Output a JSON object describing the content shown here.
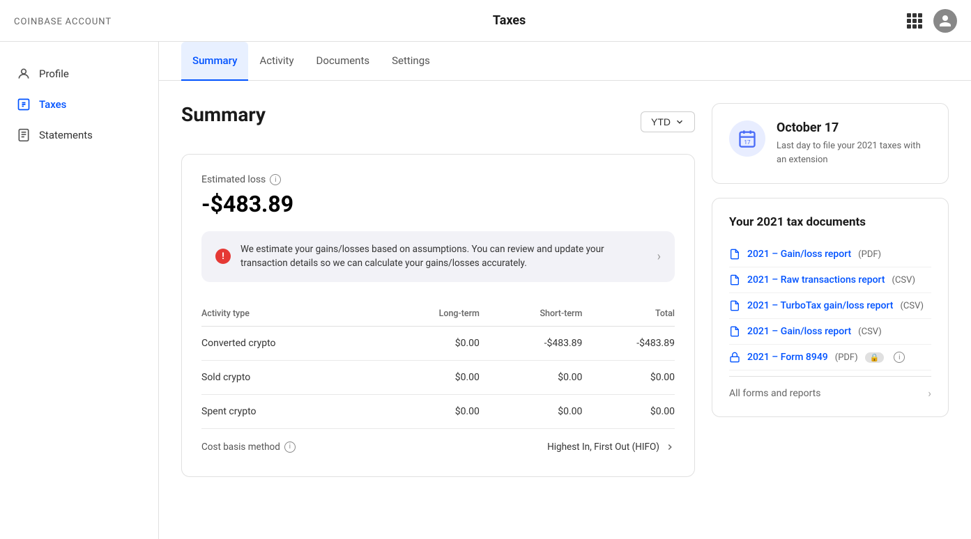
{
  "topNav": {
    "brand": "coinbase",
    "brandSuffix": "ACCOUNT",
    "title": "Taxes"
  },
  "sidebar": {
    "items": [
      {
        "id": "profile",
        "label": "Profile",
        "icon": "person-icon",
        "active": false
      },
      {
        "id": "taxes",
        "label": "Taxes",
        "icon": "taxes-icon",
        "active": true
      },
      {
        "id": "statements",
        "label": "Statements",
        "icon": "statements-icon",
        "active": false
      }
    ]
  },
  "tabs": [
    {
      "id": "summary",
      "label": "Summary",
      "active": true
    },
    {
      "id": "activity",
      "label": "Activity",
      "active": false
    },
    {
      "id": "documents",
      "label": "Documents",
      "active": false
    },
    {
      "id": "settings",
      "label": "Settings",
      "active": false
    }
  ],
  "summary": {
    "pageTitle": "Summary",
    "ytdLabel": "YTD",
    "estimatedLossLabel": "Estimated loss",
    "estimatedLossValue": "-$483.89",
    "alert": {
      "text": "We estimate your gains/losses based on assumptions. You can review and update your transaction details so we can calculate your gains/losses accurately."
    },
    "table": {
      "headers": [
        "Activity type",
        "Long-term",
        "Short-term",
        "Total"
      ],
      "rows": [
        {
          "type": "Converted crypto",
          "longTerm": "$0.00",
          "shortTerm": "-$483.89",
          "total": "-$483.89"
        },
        {
          "type": "Sold crypto",
          "longTerm": "$0.00",
          "shortTerm": "$0.00",
          "total": "$0.00"
        },
        {
          "type": "Spent crypto",
          "longTerm": "$0.00",
          "shortTerm": "$0.00",
          "total": "$0.00"
        }
      ]
    },
    "costBasis": {
      "label": "Cost basis method",
      "value": "Highest In, First Out (HIFO)"
    }
  },
  "rightPanel": {
    "dateCard": {
      "date": "October 17",
      "description": "Last day to file your 2021 taxes with an extension"
    },
    "taxDocs": {
      "title": "Your 2021 tax documents",
      "docs": [
        {
          "id": "gain-loss-pdf",
          "link": "2021 – Gain/loss report",
          "type": "(PDF)",
          "locked": false
        },
        {
          "id": "raw-transactions-csv",
          "link": "2021 – Raw transactions report",
          "type": "(CSV)",
          "locked": false
        },
        {
          "id": "turbotax-csv",
          "link": "2021 – TurboTax gain/loss report",
          "type": "(CSV)",
          "locked": false
        },
        {
          "id": "gain-loss-csv",
          "link": "2021 – Gain/loss report",
          "type": "(CSV)",
          "locked": false
        },
        {
          "id": "form-8949",
          "link": "2021 – Form 8949",
          "type": "(PDF)",
          "locked": true
        }
      ],
      "allFormsLabel": "All forms and reports"
    }
  }
}
